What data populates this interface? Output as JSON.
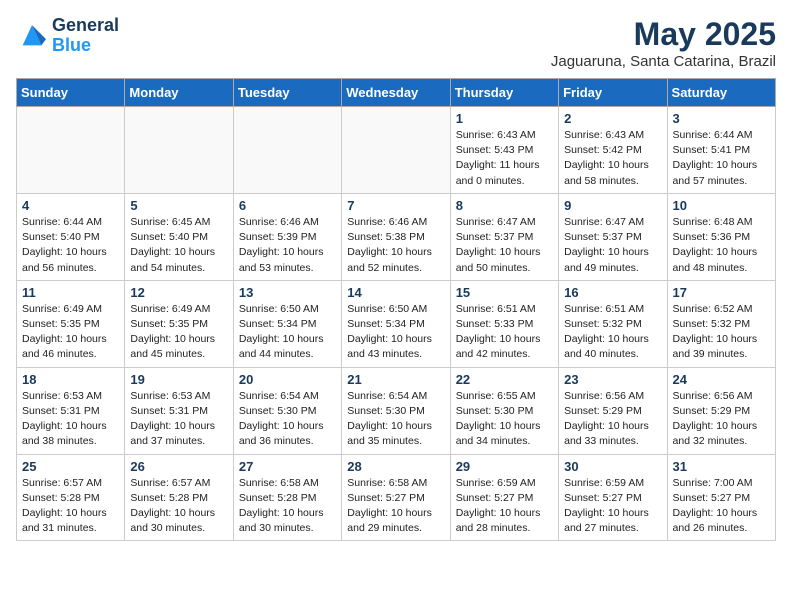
{
  "header": {
    "logo_line1": "General",
    "logo_line2": "Blue",
    "month": "May 2025",
    "location": "Jaguaruna, Santa Catarina, Brazil"
  },
  "weekdays": [
    "Sunday",
    "Monday",
    "Tuesday",
    "Wednesday",
    "Thursday",
    "Friday",
    "Saturday"
  ],
  "weeks": [
    [
      {
        "day": "",
        "info": ""
      },
      {
        "day": "",
        "info": ""
      },
      {
        "day": "",
        "info": ""
      },
      {
        "day": "",
        "info": ""
      },
      {
        "day": "1",
        "info": "Sunrise: 6:43 AM\nSunset: 5:43 PM\nDaylight: 11 hours\nand 0 minutes."
      },
      {
        "day": "2",
        "info": "Sunrise: 6:43 AM\nSunset: 5:42 PM\nDaylight: 10 hours\nand 58 minutes."
      },
      {
        "day": "3",
        "info": "Sunrise: 6:44 AM\nSunset: 5:41 PM\nDaylight: 10 hours\nand 57 minutes."
      }
    ],
    [
      {
        "day": "4",
        "info": "Sunrise: 6:44 AM\nSunset: 5:40 PM\nDaylight: 10 hours\nand 56 minutes."
      },
      {
        "day": "5",
        "info": "Sunrise: 6:45 AM\nSunset: 5:40 PM\nDaylight: 10 hours\nand 54 minutes."
      },
      {
        "day": "6",
        "info": "Sunrise: 6:46 AM\nSunset: 5:39 PM\nDaylight: 10 hours\nand 53 minutes."
      },
      {
        "day": "7",
        "info": "Sunrise: 6:46 AM\nSunset: 5:38 PM\nDaylight: 10 hours\nand 52 minutes."
      },
      {
        "day": "8",
        "info": "Sunrise: 6:47 AM\nSunset: 5:37 PM\nDaylight: 10 hours\nand 50 minutes."
      },
      {
        "day": "9",
        "info": "Sunrise: 6:47 AM\nSunset: 5:37 PM\nDaylight: 10 hours\nand 49 minutes."
      },
      {
        "day": "10",
        "info": "Sunrise: 6:48 AM\nSunset: 5:36 PM\nDaylight: 10 hours\nand 48 minutes."
      }
    ],
    [
      {
        "day": "11",
        "info": "Sunrise: 6:49 AM\nSunset: 5:35 PM\nDaylight: 10 hours\nand 46 minutes."
      },
      {
        "day": "12",
        "info": "Sunrise: 6:49 AM\nSunset: 5:35 PM\nDaylight: 10 hours\nand 45 minutes."
      },
      {
        "day": "13",
        "info": "Sunrise: 6:50 AM\nSunset: 5:34 PM\nDaylight: 10 hours\nand 44 minutes."
      },
      {
        "day": "14",
        "info": "Sunrise: 6:50 AM\nSunset: 5:34 PM\nDaylight: 10 hours\nand 43 minutes."
      },
      {
        "day": "15",
        "info": "Sunrise: 6:51 AM\nSunset: 5:33 PM\nDaylight: 10 hours\nand 42 minutes."
      },
      {
        "day": "16",
        "info": "Sunrise: 6:51 AM\nSunset: 5:32 PM\nDaylight: 10 hours\nand 40 minutes."
      },
      {
        "day": "17",
        "info": "Sunrise: 6:52 AM\nSunset: 5:32 PM\nDaylight: 10 hours\nand 39 minutes."
      }
    ],
    [
      {
        "day": "18",
        "info": "Sunrise: 6:53 AM\nSunset: 5:31 PM\nDaylight: 10 hours\nand 38 minutes."
      },
      {
        "day": "19",
        "info": "Sunrise: 6:53 AM\nSunset: 5:31 PM\nDaylight: 10 hours\nand 37 minutes."
      },
      {
        "day": "20",
        "info": "Sunrise: 6:54 AM\nSunset: 5:30 PM\nDaylight: 10 hours\nand 36 minutes."
      },
      {
        "day": "21",
        "info": "Sunrise: 6:54 AM\nSunset: 5:30 PM\nDaylight: 10 hours\nand 35 minutes."
      },
      {
        "day": "22",
        "info": "Sunrise: 6:55 AM\nSunset: 5:30 PM\nDaylight: 10 hours\nand 34 minutes."
      },
      {
        "day": "23",
        "info": "Sunrise: 6:56 AM\nSunset: 5:29 PM\nDaylight: 10 hours\nand 33 minutes."
      },
      {
        "day": "24",
        "info": "Sunrise: 6:56 AM\nSunset: 5:29 PM\nDaylight: 10 hours\nand 32 minutes."
      }
    ],
    [
      {
        "day": "25",
        "info": "Sunrise: 6:57 AM\nSunset: 5:28 PM\nDaylight: 10 hours\nand 31 minutes."
      },
      {
        "day": "26",
        "info": "Sunrise: 6:57 AM\nSunset: 5:28 PM\nDaylight: 10 hours\nand 30 minutes."
      },
      {
        "day": "27",
        "info": "Sunrise: 6:58 AM\nSunset: 5:28 PM\nDaylight: 10 hours\nand 30 minutes."
      },
      {
        "day": "28",
        "info": "Sunrise: 6:58 AM\nSunset: 5:27 PM\nDaylight: 10 hours\nand 29 minutes."
      },
      {
        "day": "29",
        "info": "Sunrise: 6:59 AM\nSunset: 5:27 PM\nDaylight: 10 hours\nand 28 minutes."
      },
      {
        "day": "30",
        "info": "Sunrise: 6:59 AM\nSunset: 5:27 PM\nDaylight: 10 hours\nand 27 minutes."
      },
      {
        "day": "31",
        "info": "Sunrise: 7:00 AM\nSunset: 5:27 PM\nDaylight: 10 hours\nand 26 minutes."
      }
    ]
  ]
}
